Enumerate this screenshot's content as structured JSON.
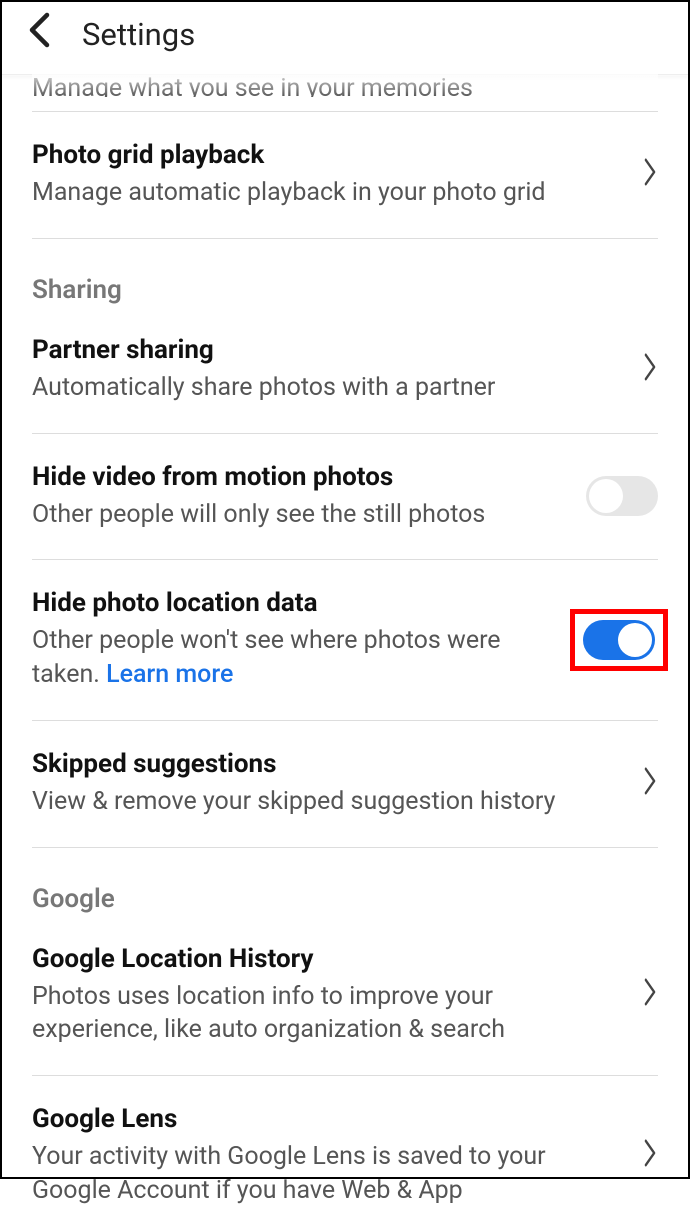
{
  "header": {
    "title": "Settings"
  },
  "cutoff": "Manage what you see in your memories",
  "items": {
    "playback": {
      "title": "Photo grid playback",
      "sub": "Manage automatic playback in your photo grid"
    },
    "sharingSection": "Sharing",
    "partner": {
      "title": "Partner sharing",
      "sub": "Automatically share photos with a partner"
    },
    "hideVideo": {
      "title": "Hide video from motion photos",
      "sub": "Other people will only see the still photos"
    },
    "hideLocation": {
      "title": "Hide photo location data",
      "sub": "Other people won't see where photos were taken. ",
      "link": "Learn more"
    },
    "skipped": {
      "title": "Skipped suggestions",
      "sub": "View & remove your skipped suggestion history"
    },
    "googleSection": "Google",
    "locationHistory": {
      "title": "Google Location History",
      "sub": "Photos uses location info to improve your experience, like auto organization & search"
    },
    "lens": {
      "title": "Google Lens",
      "sub": "Your activity with Google Lens is saved to your Google Account if you have Web & App"
    }
  }
}
